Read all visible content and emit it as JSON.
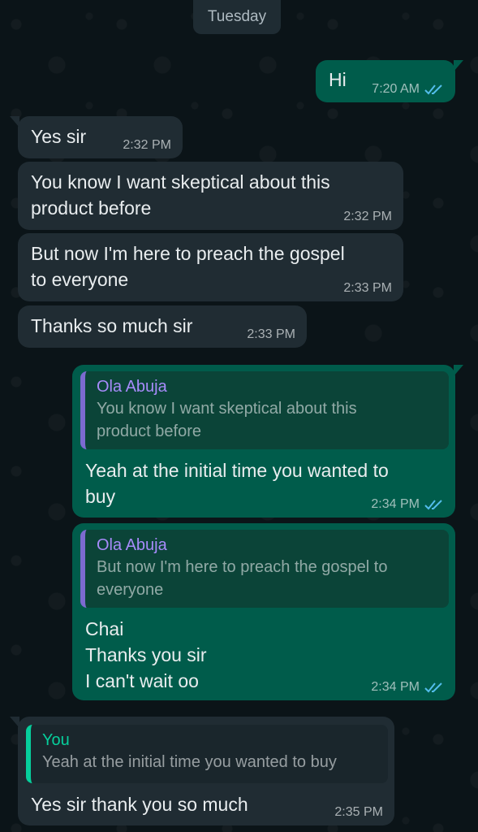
{
  "date_separator": "Tuesday",
  "messages": [
    {
      "text": "Hi",
      "time": "7:20 AM"
    },
    {
      "text": "Yes sir",
      "time": "2:32 PM"
    },
    {
      "text": "You know I want skeptical about this\nproduct before",
      "time": "2:32 PM"
    },
    {
      "text": "But now I'm here to preach the gospel\nto everyone",
      "time": "2:33 PM"
    },
    {
      "text": "Thanks so much sir",
      "time": "2:33 PM"
    },
    {
      "quote_name": "Ola Abuja",
      "quote_text": "You know I want skeptical about this\nproduct before",
      "text": "Yeah at the initial time you wanted to\nbuy",
      "time": "2:34 PM"
    },
    {
      "quote_name": "Ola Abuja",
      "quote_text": "But now I'm here to preach the gospel to\neveryone",
      "text": "Chai\nThanks you sir\nI can't wait oo",
      "time": "2:34 PM"
    },
    {
      "quote_name": "You",
      "quote_text": "Yeah at the initial time you wanted to buy",
      "text": "Yes sir thank you so much",
      "time": "2:35 PM"
    }
  ],
  "colors": {
    "background": "#0b1418",
    "incoming_bubble": "#202c33",
    "outgoing_bubble": "#005c4b",
    "read_ticks": "#53bdeb",
    "quote_name_contact": "#a78bfa",
    "quote_name_you": "#06cf9c"
  },
  "icons": {
    "read_receipt": "double-check-icon"
  }
}
